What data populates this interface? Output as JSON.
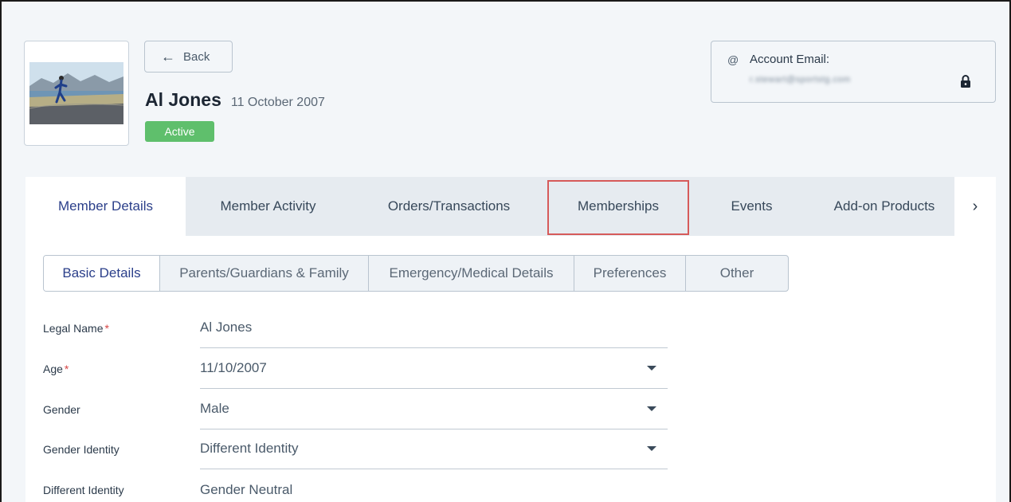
{
  "header": {
    "back_label": "Back",
    "member_name": "Al Jones",
    "member_dob": "11 October 2007",
    "status": "Active",
    "account_email_label": "Account Email:",
    "account_email_value": "r.stewart@sportstg.com",
    "at_symbol": "@"
  },
  "tabs": [
    {
      "label": "Member Details"
    },
    {
      "label": "Member Activity"
    },
    {
      "label": "Orders/Transactions"
    },
    {
      "label": "Memberships"
    },
    {
      "label": "Events"
    },
    {
      "label": "Add-on Products"
    }
  ],
  "tab_next_glyph": "›",
  "subtabs": [
    {
      "label": "Basic Details"
    },
    {
      "label": "Parents/Guardians & Family"
    },
    {
      "label": "Emergency/Medical Details"
    },
    {
      "label": "Preferences"
    },
    {
      "label": "Other"
    }
  ],
  "fields": [
    {
      "label": "Legal Name",
      "required": "*",
      "value": "Al Jones"
    },
    {
      "label": "Age",
      "required": "*",
      "value": "11/10/2007"
    },
    {
      "label": "Gender",
      "required": "",
      "value": "Male"
    },
    {
      "label": "Gender Identity",
      "required": "",
      "value": "Different Identity"
    },
    {
      "label": "Different Identity",
      "required": "",
      "value": "Gender Neutral"
    }
  ],
  "colors": {
    "accent": "#2b3f8a",
    "status_green": "#5fbf6c",
    "highlight_red": "#d65a5a",
    "required_red": "#d64545"
  },
  "icons": {
    "back": "arrow-left-icon",
    "email": "at-icon",
    "lock": "lock-icon",
    "tab_next": "chevron-right-icon",
    "dropdown": "caret-down-icon"
  }
}
